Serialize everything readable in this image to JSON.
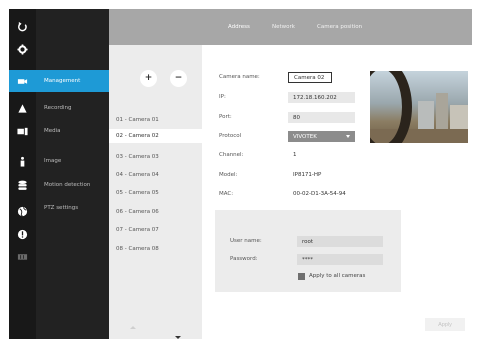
{
  "sidebar": {
    "icons": [
      "back-icon",
      "settings-icon",
      "camera-icon",
      "recording-icon",
      "media-icon",
      "user-icon",
      "database-icon",
      "network-icon",
      "info-icon",
      "storage-icon"
    ],
    "items": [
      {
        "label": "Management"
      },
      {
        "label": "Recording"
      },
      {
        "label": "Media"
      },
      {
        "label": "Image"
      },
      {
        "label": "Motion detection"
      },
      {
        "label": "PTZ settings"
      }
    ]
  },
  "camera_list": {
    "add_label": "+",
    "remove_label": "−",
    "items": [
      "01 - Camera 01",
      "02 - Camera 02",
      "03 - Camera 03",
      "04 - Camera 04",
      "05 - Camera 05",
      "06 - Camera 06",
      "07 - Camera 07",
      "08 - Camera 08"
    ],
    "selected_index": 1
  },
  "tabs": [
    {
      "label": "Address"
    },
    {
      "label": "Network"
    },
    {
      "label": "Camera position"
    }
  ],
  "form": {
    "camera_name_label": "Camera name:",
    "camera_name_value": "Camera 02",
    "ip_label": "IP:",
    "ip_value": "172.18.160.202",
    "port_label": "Port:",
    "port_value": "80",
    "protocol_label": "Protocol",
    "protocol_value": "VIVOTEK",
    "channel_label": "Channel:",
    "channel_value": "1",
    "model_label": "Model:",
    "model_value": "IP8171-HP",
    "mac_label": "MAC:",
    "mac_value": "00-02-D1-3A-54-94"
  },
  "auth": {
    "user_label": "User name:",
    "user_value": "root",
    "password_label": "Password:",
    "password_value": "****",
    "apply_all_label": "Apply to all cameras"
  },
  "apply_label": "Apply",
  "colors": {
    "accent": "#1e9ad6",
    "header": "#a7a7a7",
    "rail": "#181818",
    "menu": "#222222"
  }
}
